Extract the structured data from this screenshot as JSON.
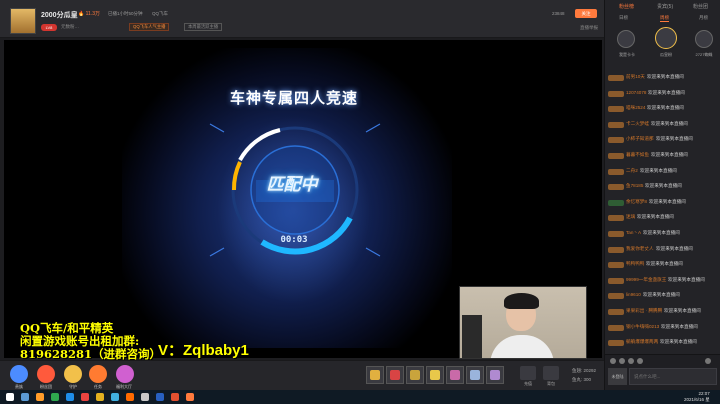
{
  "header": {
    "room_title": "2000分瓜皇",
    "hot_value": "11.3万",
    "online": "已播1小时50分钟",
    "category": "QQ飞车",
    "level": "LV8",
    "user_count": "元数粉…",
    "fan_tag": "QQ飞车人气主播",
    "biz_tag": "本周最活跃主播",
    "follow_count": "23848",
    "follow_label": "关注",
    "report_label": "直播举报"
  },
  "stage": {
    "game_title": "车神专属四人竞速",
    "status_text": "匹配中",
    "timer": "00:03",
    "ad_line_1": "QQ飞车/和平精英",
    "ad_line_2": "闲置游戏账号出租加群:",
    "ad_line_3": "819628281（进群咨询）",
    "wechat": "V：Zqlbaby1"
  },
  "toolbar": {
    "items": [
      {
        "label": "贵族",
        "color": "#4c8cff"
      },
      {
        "label": "粉丝团",
        "color": "#ff5a3c"
      },
      {
        "label": "守护",
        "color": "#f2c04a"
      },
      {
        "label": "任务",
        "color": "#ff7b31"
      },
      {
        "label": "福利大厅",
        "color": "#d060d0"
      }
    ],
    "gifts": [
      "#e1b040",
      "#d84444",
      "#c9a43c",
      "#e8c84a",
      "#c96aa8",
      "#9ab4dc",
      "#b08ad0"
    ],
    "side_buttons": [
      "充值",
      "背包"
    ],
    "balance_label": "鱼翅: 20292",
    "balance_label_2": "鱼丸: 300"
  },
  "sidebar": {
    "tabs": [
      "粉丝榜",
      "贵宾(5)",
      "粉丝团"
    ],
    "active_tab": 0,
    "subtabs": [
      "日榜",
      "周榜",
      "月榜"
    ],
    "active_subtab": 1,
    "ranks": [
      "我是卡卡",
      "瓜皇粉",
      "2727蜘蛛"
    ],
    "welcome_suffix": "欢迎来到本直播间",
    "chat": [
      {
        "name": "前男10天",
        "plain": false
      },
      {
        "name": "12074078",
        "plain": false
      },
      {
        "name": "喵咪2524",
        "plain": false
      },
      {
        "name": "卡二火梦蛙",
        "plain": false
      },
      {
        "name": "小柿子知道那",
        "plain": false
      },
      {
        "name": "暮暮不如鱼",
        "plain": false
      },
      {
        "name": "二舟2",
        "plain": false
      },
      {
        "name": "鱼78185",
        "plain": false
      },
      {
        "name": "余忆寒梦8",
        "plain": true
      },
      {
        "name": "迷璃",
        "plain": false
      },
      {
        "name": "Tan丶A",
        "plain": false
      },
      {
        "name": "我爱你老丈人",
        "plain": false
      },
      {
        "name": "鸭鸭鸭鸭",
        "plain": false
      },
      {
        "name": "99999一年金盏旗王",
        "plain": false
      },
      {
        "name": "lin9610",
        "plain": false
      },
      {
        "name": "果果彩出 · 腾腾腾",
        "plain": false
      },
      {
        "name": "钢小牛嗨嗨0213",
        "plain": false
      },
      {
        "name": "躺躺爆爆爆两两",
        "plain": false
      }
    ],
    "send_label": "未登陆",
    "input_placeholder": "说点什么吧..."
  },
  "taskbar": {
    "icons": [
      "#ffffff",
      "#5b9bd5",
      "#ff9c2a",
      "#2fa84f",
      "#1f8ee8",
      "#e64340",
      "#e0b020",
      "#40b0e0",
      "#ff6a00",
      "#c8c8c8",
      "#2860c0",
      "#e05030",
      "#ff7a3d"
    ],
    "time": "22:07",
    "date": "2021/6/16 星"
  }
}
